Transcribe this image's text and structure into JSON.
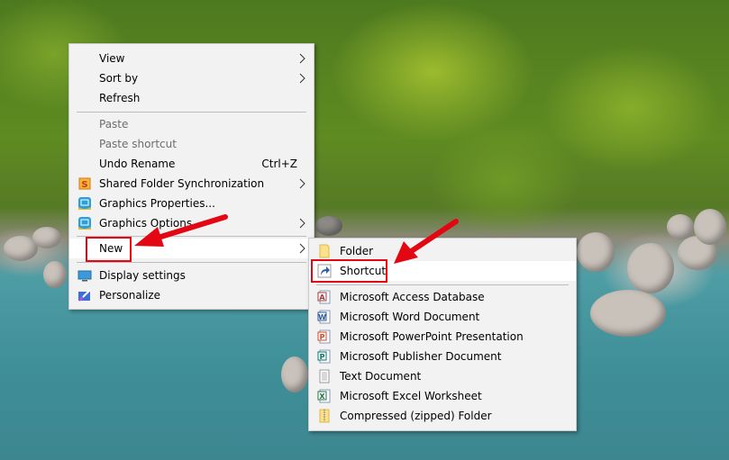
{
  "context_menu": {
    "items": [
      {
        "label": "View",
        "submenu": true
      },
      {
        "label": "Sort by",
        "submenu": true
      },
      {
        "label": "Refresh"
      },
      {
        "label": "Paste",
        "disabled": true
      },
      {
        "label": "Paste shortcut",
        "disabled": true
      },
      {
        "label": "Undo Rename",
        "shortcut": "Ctrl+Z"
      },
      {
        "label": "Shared Folder Synchronization",
        "icon": "shared-folder-sync-icon",
        "submenu": true
      },
      {
        "label": "Graphics Properties...",
        "icon": "intel-graphics-icon"
      },
      {
        "label": "Graphics Options",
        "icon": "intel-graphics-icon",
        "submenu": true
      },
      {
        "label": "New",
        "submenu": true,
        "highlighted": true
      },
      {
        "label": "Display settings",
        "icon": "display-settings-icon"
      },
      {
        "label": "Personalize",
        "icon": "personalize-icon"
      }
    ]
  },
  "new_submenu": {
    "items": [
      {
        "label": "Folder",
        "icon": "folder-icon"
      },
      {
        "label": "Shortcut",
        "icon": "shortcut-icon",
        "highlighted": true
      },
      {
        "label": "Microsoft Access Database",
        "icon": "access-icon"
      },
      {
        "label": "Microsoft Word Document",
        "icon": "word-icon"
      },
      {
        "label": "Microsoft PowerPoint Presentation",
        "icon": "powerpoint-icon"
      },
      {
        "label": "Microsoft Publisher Document",
        "icon": "publisher-icon"
      },
      {
        "label": "Text Document",
        "icon": "text-document-icon"
      },
      {
        "label": "Microsoft Excel Worksheet",
        "icon": "excel-icon"
      },
      {
        "label": "Compressed (zipped) Folder",
        "icon": "zip-folder-icon"
      }
    ]
  },
  "annotation": {
    "color": "#e30613"
  }
}
